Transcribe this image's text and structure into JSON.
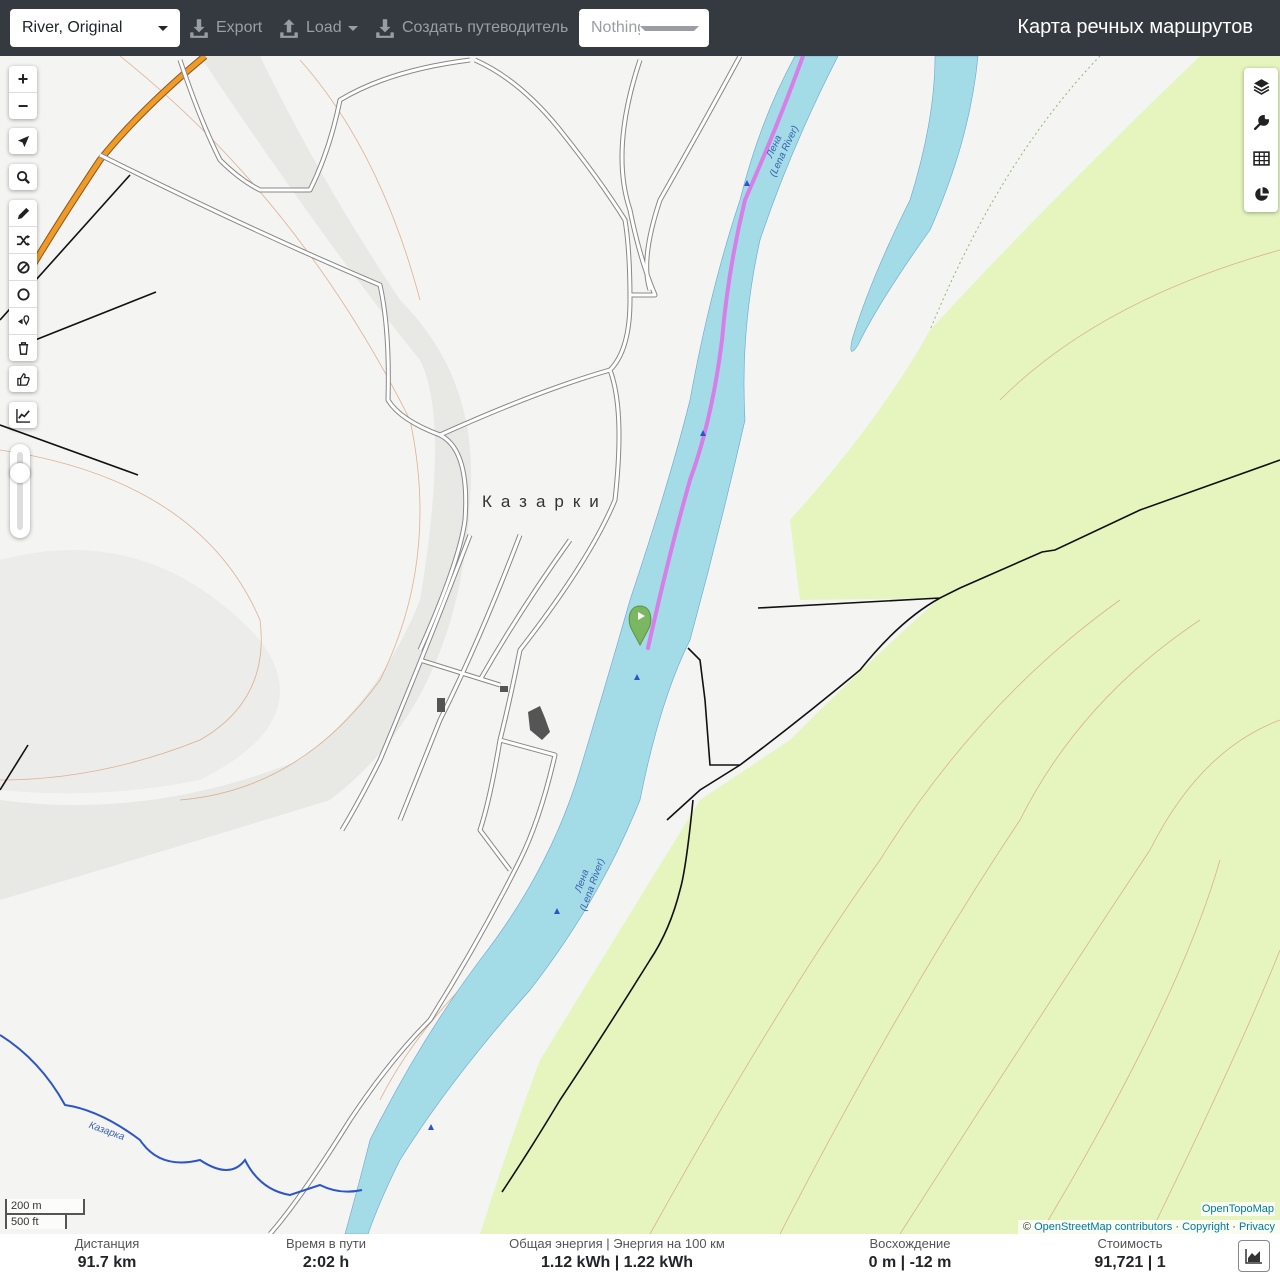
{
  "header": {
    "profile_value": "River, Original",
    "export_label": "Export",
    "load_label": "Load",
    "guide_label": "Создать путеводитель",
    "selection_placeholder": "Nothing selected",
    "app_title": "Карта речных маршрутов"
  },
  "map": {
    "place_label": "Казарки",
    "river_label_1": "Лена",
    "river_label_1b": "(Lena River)",
    "river_label_2": "Лена",
    "river_label_2b": "(Lena River)",
    "stream_label": "Казарка",
    "scale_metric": "200 m",
    "scale_imperial": "500 ft",
    "layer_name": "OpenTopoMap",
    "attribution_prefix": "©",
    "attribution_osm": "OpenStreetMap contributors",
    "attribution_sep1": "·",
    "attribution_copyright": "Copyright",
    "attribution_sep2": "·",
    "attribution_privacy": "Privacy",
    "colors": {
      "water": "#a3dbe6",
      "forest": "#e6f5be",
      "route": "#d87ee8",
      "road": "#f09a2a"
    },
    "left_toolbar_icons": [
      "zoom-in-icon",
      "zoom-out-icon",
      "locate-icon",
      "search-icon",
      "draw-icon",
      "shuffle-icon",
      "nogo-icon",
      "circle-icon",
      "poi-icon",
      "trash-icon",
      "thumbs-icon",
      "elevation-icon"
    ],
    "right_toolbar_icons": [
      "layers-icon",
      "wrench-icon",
      "table-icon",
      "pie-chart-icon"
    ]
  },
  "footer": {
    "distance_label": "Дистанция",
    "distance_value": "91.7 km",
    "time_label": "Время в пути",
    "time_value": "2:02 h",
    "energy_label": "Общая энергия | Энергия на 100 км",
    "energy_value": "1.12 kWh | 1.22 kWh",
    "ascent_label": "Восхождение",
    "ascent_value": "0 m | -12 m",
    "cost_label": "Стоимость",
    "cost_value": "91,721 | 1"
  }
}
